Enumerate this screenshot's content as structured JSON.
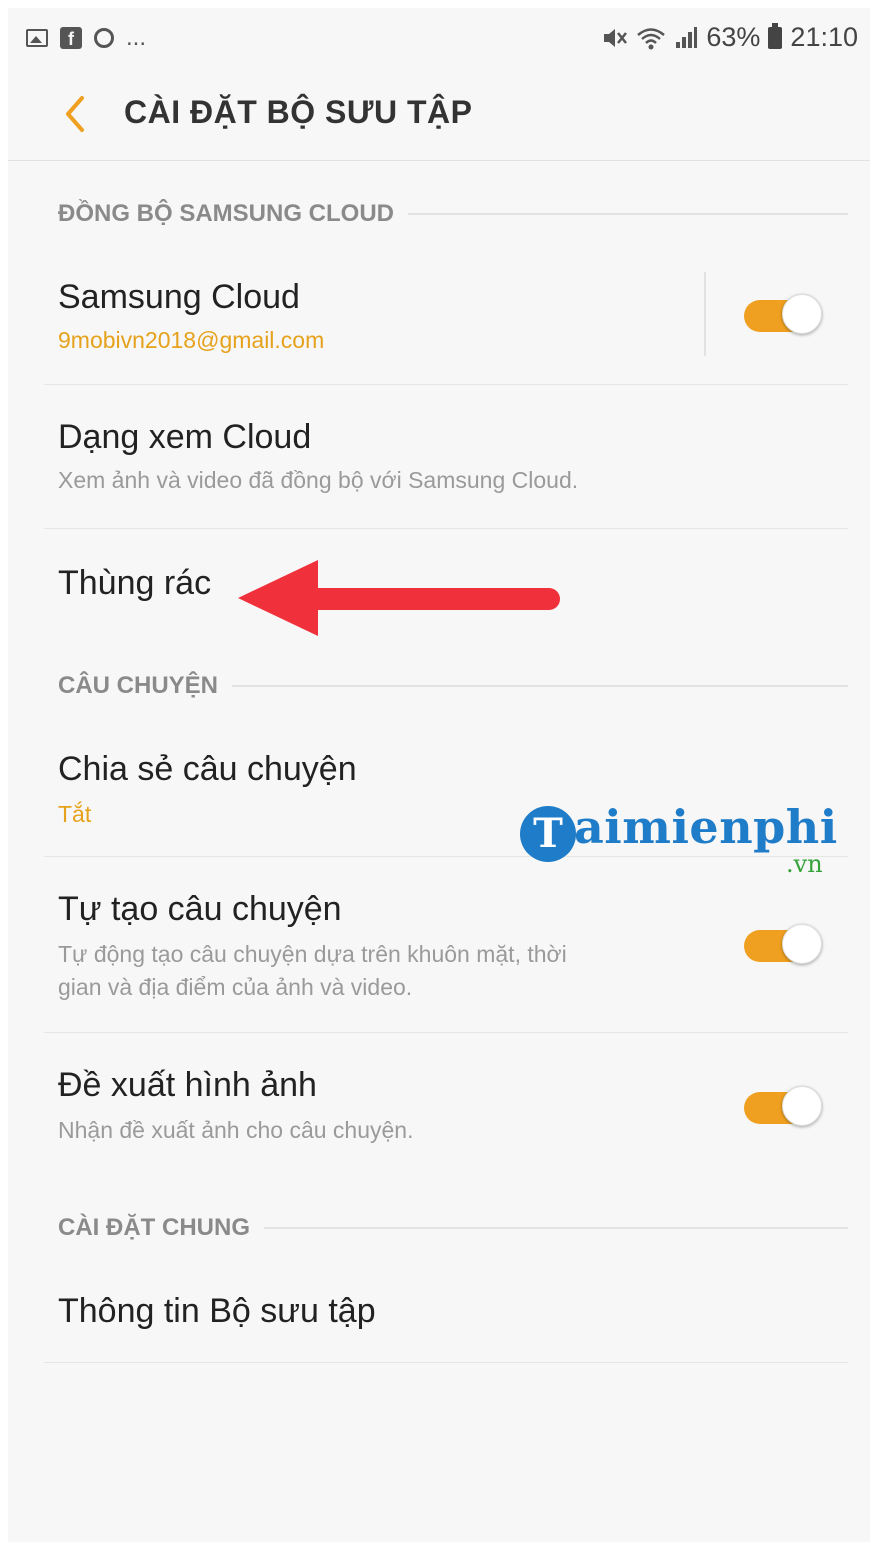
{
  "status_bar": {
    "left_icons": [
      "image-icon",
      "facebook-icon",
      "circle-app-icon"
    ],
    "more": "...",
    "right_icons": [
      "mute-icon",
      "wifi-icon",
      "signal-icon",
      "battery-icon"
    ],
    "battery_percent": "63%",
    "time": "21:10"
  },
  "header": {
    "title": "CÀI ĐẶT BỘ SƯU TẬP",
    "back_icon": "chevron-left-icon"
  },
  "sections": {
    "sync": "ĐỒNG BỘ SAMSUNG CLOUD",
    "stories": "CÂU CHUYỆN",
    "general": "CÀI ĐẶT CHUNG"
  },
  "items": {
    "samsung_cloud": {
      "title": "Samsung Cloud",
      "subtitle": "9mobivn2018@gmail.com",
      "toggle_on": true
    },
    "cloud_view": {
      "title": "Dạng xem Cloud",
      "subtitle": "Xem ảnh và video đã đồng bộ với Samsung Cloud."
    },
    "trash": {
      "title": "Thùng rác"
    },
    "share_story": {
      "title": "Chia sẻ câu chuyện",
      "subtitle": "Tắt"
    },
    "auto_story": {
      "title": "Tự tạo câu chuyện",
      "subtitle_line1": "Tự động tạo câu chuyện dựa trên khuôn mặt, thời",
      "subtitle_line2": "gian và địa điểm của ảnh và video.",
      "toggle_on": true
    },
    "suggest_images": {
      "title": "Đề xuất hình ảnh",
      "subtitle": "Nhận đề xuất ảnh cho câu chuyện.",
      "toggle_on": true
    },
    "about": {
      "title": "Thông tin Bộ sưu tập"
    }
  },
  "watermark": {
    "letter": "T",
    "text": "aimienphi",
    "suffix": ".vn"
  },
  "colors": {
    "accent": "#f0a020",
    "annotation_arrow": "#f0303a",
    "watermark_blue": "#1e7cc8",
    "watermark_green": "#35a33a"
  }
}
